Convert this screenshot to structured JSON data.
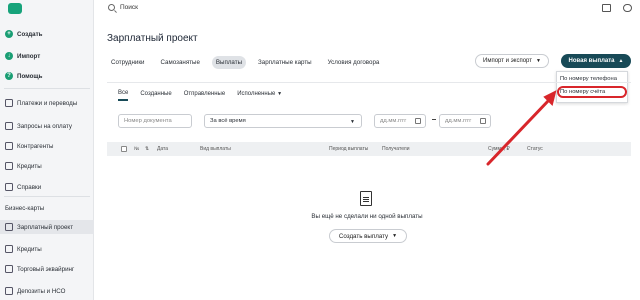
{
  "search": {
    "placeholder": "Поиск"
  },
  "sidebar": {
    "top_items": [
      {
        "label": "Создать"
      },
      {
        "label": "Импорт"
      },
      {
        "label": "Помощь"
      }
    ],
    "items": [
      {
        "label": "Платежи и переводы"
      },
      {
        "label": "Запросы на оплату"
      },
      {
        "label": "Контрагенты"
      },
      {
        "label": "Кредиты"
      },
      {
        "label": "Справки"
      },
      {
        "label": "Бизнес-карты"
      },
      {
        "label": "Зарплатный проект"
      },
      {
        "label": "Кредиты"
      },
      {
        "label": "Торговый эквайринг"
      },
      {
        "label": "Депозиты и НСО"
      }
    ],
    "active_index": 6
  },
  "main": {
    "title": "Зарплатный проект",
    "tabs": [
      {
        "label": "Сотрудники"
      },
      {
        "label": "Самозанятые"
      },
      {
        "label": "Выплаты"
      },
      {
        "label": "Зарплатные карты"
      },
      {
        "label": "Условия договора"
      }
    ],
    "selected_tab": 2,
    "import_button": "Импорт и экспорт",
    "new_payment_button": "Новая выплата",
    "dropdown": [
      {
        "label": "По номеру телефона"
      },
      {
        "label": "По номеру счёта"
      }
    ],
    "subtabs": [
      {
        "label": "Все"
      },
      {
        "label": "Созданные"
      },
      {
        "label": "Отправленные"
      },
      {
        "label": "Исполненные"
      }
    ],
    "filters": {
      "doc_number_placeholder": "Номер документа",
      "period": "За всё время",
      "date_from_placeholder": "дд.мм.гггг",
      "date_to_placeholder": "дд.мм.гггг"
    },
    "table_headers": [
      "№",
      "Дата",
      "Вид выплаты",
      "Период выплаты",
      "Получатели",
      "Сумма, ₽",
      "Статус"
    ],
    "empty_text": "Вы ещё не сделали ни одной выплаты",
    "create_button": "Создать выплату"
  },
  "colors": {
    "accent": "#184a57",
    "brand": "#17a37b",
    "highlight": "#d8262b"
  }
}
